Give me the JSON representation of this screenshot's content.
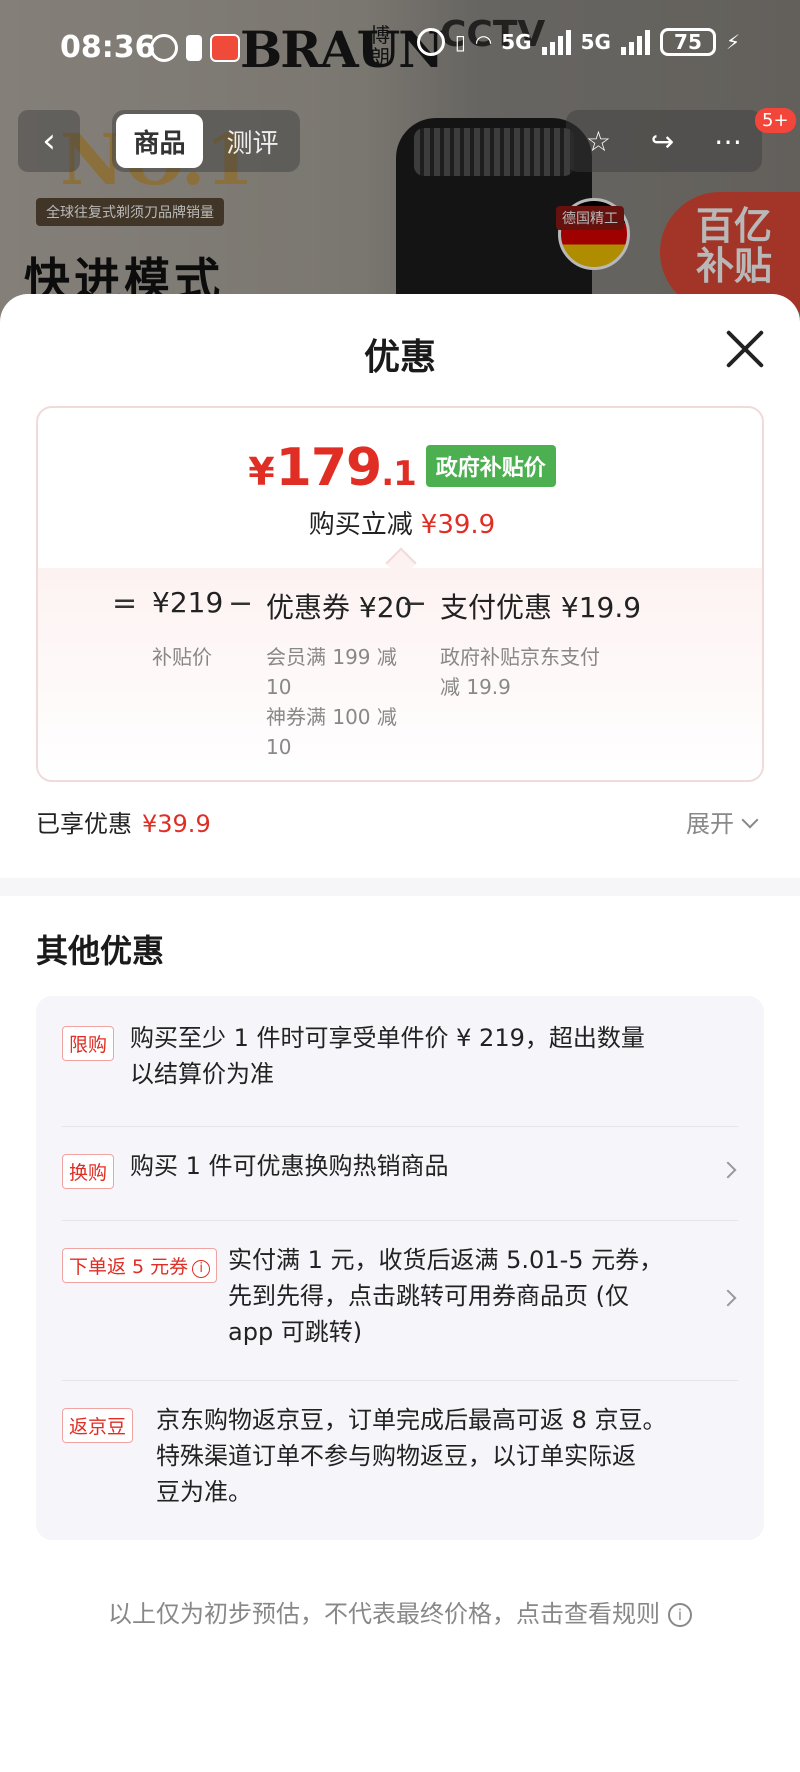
{
  "status_bar": {
    "time": "08:36",
    "network_1": "5G",
    "network_2": "5G",
    "battery": "75"
  },
  "background": {
    "brand": "BRAUN",
    "brand_cn": "博朗",
    "cctv": "CCTV",
    "nav_tabs": [
      "商品",
      "测评"
    ],
    "nav_badge": "5+",
    "promo_no1": "NO.1",
    "promo_sub": "全球往复式剃须刀品牌销量",
    "promo_headline": "快进模式",
    "made_label": "德国精工",
    "subsidy": [
      "百亿",
      "补贴"
    ]
  },
  "sheet": {
    "title": "优惠",
    "price": {
      "symbol": "¥",
      "integer": "179",
      "decimal": ".1",
      "tag": "政府补贴价"
    },
    "instant_off": {
      "label": "购买立减",
      "amount": "¥39.9"
    },
    "calc": {
      "eq": "=",
      "minus": "−",
      "base_value": "¥219",
      "base_label": "补贴价",
      "coupon_value": "优惠券 ¥20",
      "coupon_notes": [
        "会员满 199 减",
        "10",
        "神券满 100 减",
        "10"
      ],
      "pay_value": "支付优惠 ¥19.9",
      "pay_notes": [
        "政府补贴京东支付",
        "减 19.9"
      ]
    },
    "enjoyed": {
      "label": "已享优惠",
      "amount": "¥39.9"
    },
    "expand_label": "展开",
    "other_title": "其他优惠",
    "promos": [
      {
        "tag": "限购",
        "lines": [
          "购买至少 1 件时可享受单件价 ¥ 219，超出数量",
          "以结算价为准"
        ],
        "has_arrow": false
      },
      {
        "tag": "换购",
        "lines": [
          "购买 1 件可优惠换购热销商品"
        ],
        "has_arrow": true
      },
      {
        "tag": "下单返 5 元券",
        "lines": [
          "实付满 1 元，收货后返满 5.01-5 元券，",
          "先到先得，点击跳转可用券商品页 (仅",
          "app 可跳转)"
        ],
        "has_arrow": true
      },
      {
        "tag": "返京豆",
        "lines": [
          "京东购物返京豆，订单完成后最高可返 8 京豆。",
          "特殊渠道订单不参与购物返豆，以订单实际返",
          "豆为准。"
        ],
        "has_arrow": false
      }
    ],
    "disclaimer": "以上仅为初步预估，不代表最终价格，点击查看规则"
  },
  "colors": {
    "accent_red": "#e02e24",
    "gov_green": "#4caf50",
    "muted_gray": "#888888"
  }
}
